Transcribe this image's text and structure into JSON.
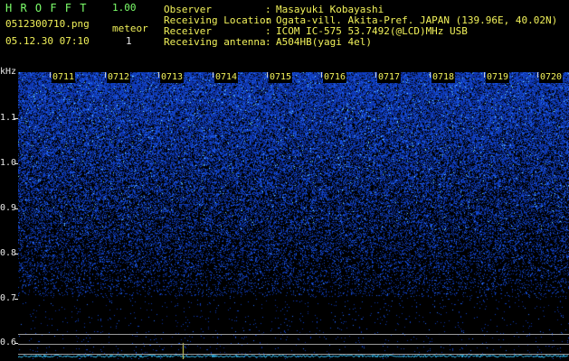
{
  "app": {
    "title": "H R O F F T",
    "version": "1.00"
  },
  "file": {
    "name": "0512300710.png",
    "datetime": "05.12.30 07:10"
  },
  "meteor": {
    "label": "meteor",
    "count": "1"
  },
  "info": [
    {
      "label": "Observer",
      "sep": ":",
      "value": "Masayuki Kobayashi"
    },
    {
      "label": "Receiving Location",
      "sep": ":",
      "value": "Ogata-vill. Akita-Pref. JAPAN (139.96E, 40.02N)"
    },
    {
      "label": "Receiver",
      "sep": ":",
      "value": "ICOM IC-575 53.7492(@LCD)MHz USB"
    },
    {
      "label": "Receiving antenna",
      "sep": ":",
      "value": "A504HB(yagi 4el)"
    }
  ],
  "y_axis": {
    "unit": "kHz",
    "ticks": [
      "1.1",
      "1.0",
      "0.9",
      "0.8",
      "0.7",
      "0.6"
    ]
  },
  "x_axis": {
    "ticks": [
      "0711",
      "0712",
      "0713",
      "0714",
      "0715",
      "0716",
      "0717",
      "0718",
      "0719",
      "0720"
    ]
  },
  "colors": {
    "label_green": "#7cff6a",
    "label_yellow": "#f2f25a",
    "noise_blue": "#1a3cff",
    "signal_cyan": "#38e0ff"
  }
}
